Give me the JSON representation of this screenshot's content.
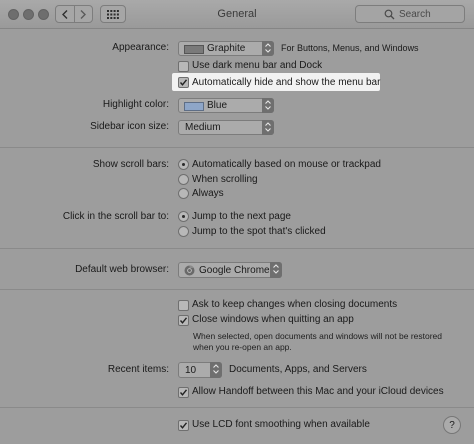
{
  "window": {
    "title": "General",
    "search_placeholder": "Search"
  },
  "appearance": {
    "label": "Appearance:",
    "value": "Graphite",
    "note": "For Buttons, Menus, and Windows"
  },
  "dark_menu": {
    "label": "Use dark menu bar and Dock",
    "checked": false
  },
  "auto_hide": {
    "label": "Automatically hide and show the menu bar",
    "checked": true
  },
  "highlight": {
    "label": "Highlight color:",
    "value": "Blue",
    "swatch": "#8ea6c8"
  },
  "sidebar": {
    "label": "Sidebar icon size:",
    "value": "Medium"
  },
  "scroll_bars": {
    "label": "Show scroll bars:",
    "options": [
      "Automatically based on mouse or trackpad",
      "When scrolling",
      "Always"
    ],
    "selected": 0
  },
  "click_scroll": {
    "label": "Click in the scroll bar to:",
    "options": [
      "Jump to the next page",
      "Jump to the spot that's clicked"
    ],
    "selected": 0
  },
  "browser": {
    "label": "Default web browser:",
    "value": "Google Chrome"
  },
  "ask_keep": {
    "label": "Ask to keep changes when closing documents",
    "checked": false
  },
  "close_windows": {
    "label": "Close windows when quitting an app",
    "checked": true,
    "note_line1": "When selected, open documents and windows will not be restored",
    "note_line2": "when you re-open an app."
  },
  "recent": {
    "label": "Recent items:",
    "value": "10",
    "suffix": "Documents, Apps, and Servers"
  },
  "handoff": {
    "label": "Allow Handoff between this Mac and your iCloud devices",
    "checked": true
  },
  "lcd": {
    "label": "Use LCD font smoothing when available",
    "checked": true
  },
  "help": {
    "label": "?"
  }
}
